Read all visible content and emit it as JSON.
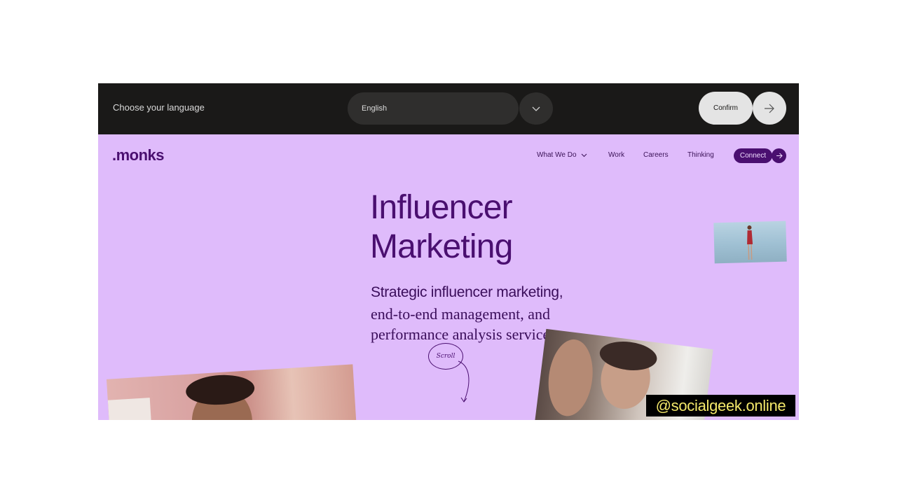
{
  "language_bar": {
    "label": "Choose your language",
    "selected_language": "English",
    "confirm_label": "Confirm"
  },
  "nav": {
    "logo": ".monks",
    "items": [
      {
        "label": "What We Do"
      },
      {
        "label": "Work"
      },
      {
        "label": "Careers"
      },
      {
        "label": "Thinking"
      }
    ],
    "connect_label": "Connect"
  },
  "hero": {
    "title_line1": "Influencer",
    "title_line2": "Marketing",
    "subtitle_strong": "Strategic influencer marketing,",
    "subtitle_rest": "end-to-end management, and performance analysis services.",
    "scroll_label": "Scroll"
  },
  "watermark": "@socialgeek.online",
  "colors": {
    "brand_purple": "#4a0f70",
    "background_lilac": "#dfbbfb",
    "language_bar": "#1a1918"
  },
  "icons": {
    "language_dropdown": "chevron-down-icon",
    "confirm": "arrow-right-icon",
    "nav_dropdown": "chevron-down-icon",
    "connect": "arrow-right-icon"
  }
}
